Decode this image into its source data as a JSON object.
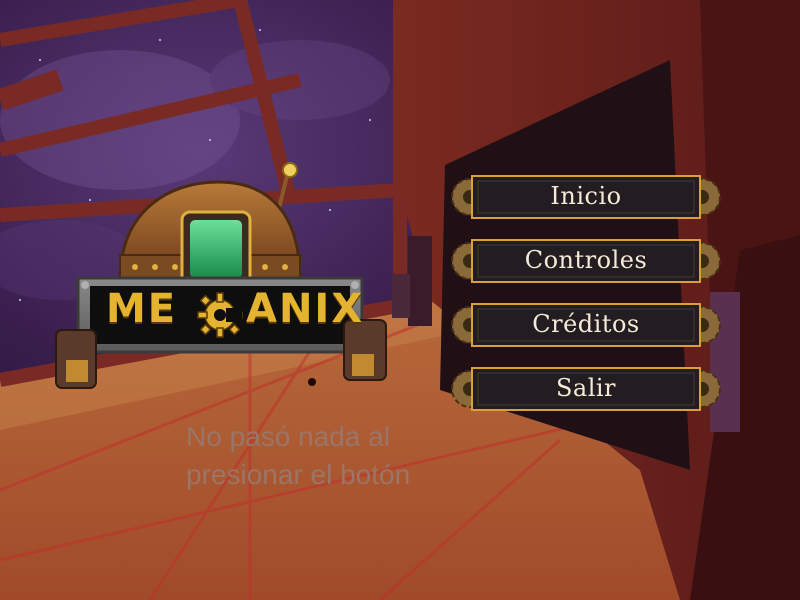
{
  "logo": {
    "title_left": "ME",
    "title_right": "ANIX"
  },
  "menu": {
    "items": [
      {
        "label": "Inicio"
      },
      {
        "label": "Controles"
      },
      {
        "label": "Créditos"
      },
      {
        "label": "Salir"
      }
    ]
  },
  "status_message": "No pasó nada al presionar el botón",
  "colors": {
    "button_fill": "#231d21",
    "button_border": "#d9a03a",
    "button_text": "#f3ead8",
    "logo_gold": "#e4b431",
    "status_text": "#9a7568"
  },
  "icons": {
    "button_ornament": "gear-icon",
    "logo_letter_c": "gear-icon"
  }
}
